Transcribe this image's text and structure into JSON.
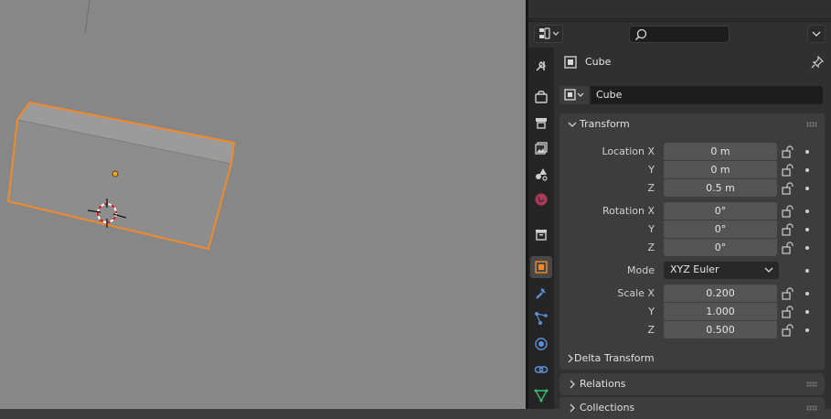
{
  "properties": {
    "object_name": "Cube",
    "data_name": "Cube",
    "transform": {
      "title": "Transform",
      "location": [
        {
          "label": "Location X",
          "value": "0 m"
        },
        {
          "label": "Y",
          "value": "0 m"
        },
        {
          "label": "Z",
          "value": "0.5 m"
        }
      ],
      "rotation": [
        {
          "label": "Rotation X",
          "value": "0°"
        },
        {
          "label": "Y",
          "value": "0°"
        },
        {
          "label": "Z",
          "value": "0°"
        }
      ],
      "mode_label": "Mode",
      "mode_value": "XYZ Euler",
      "scale": [
        {
          "label": "Scale X",
          "value": "0.200"
        },
        {
          "label": "Y",
          "value": "1.000"
        },
        {
          "label": "Z",
          "value": "0.500"
        }
      ],
      "delta_transform": "Delta Transform"
    },
    "relations": "Relations",
    "collections": "Collections"
  },
  "colors": {
    "viewport_bg": "#878787",
    "selection_outline": "#f08a2a",
    "active_tab_accent": "#f08a2a"
  },
  "tabs": [
    "tool-icon",
    "render-icon",
    "output-icon",
    "view-layer-icon",
    "scene-icon",
    "world-icon",
    "collection-icon",
    "object-icon",
    "modifier-icon",
    "particles-icon",
    "physics-icon",
    "constraints-icon",
    "object-data-icon"
  ]
}
